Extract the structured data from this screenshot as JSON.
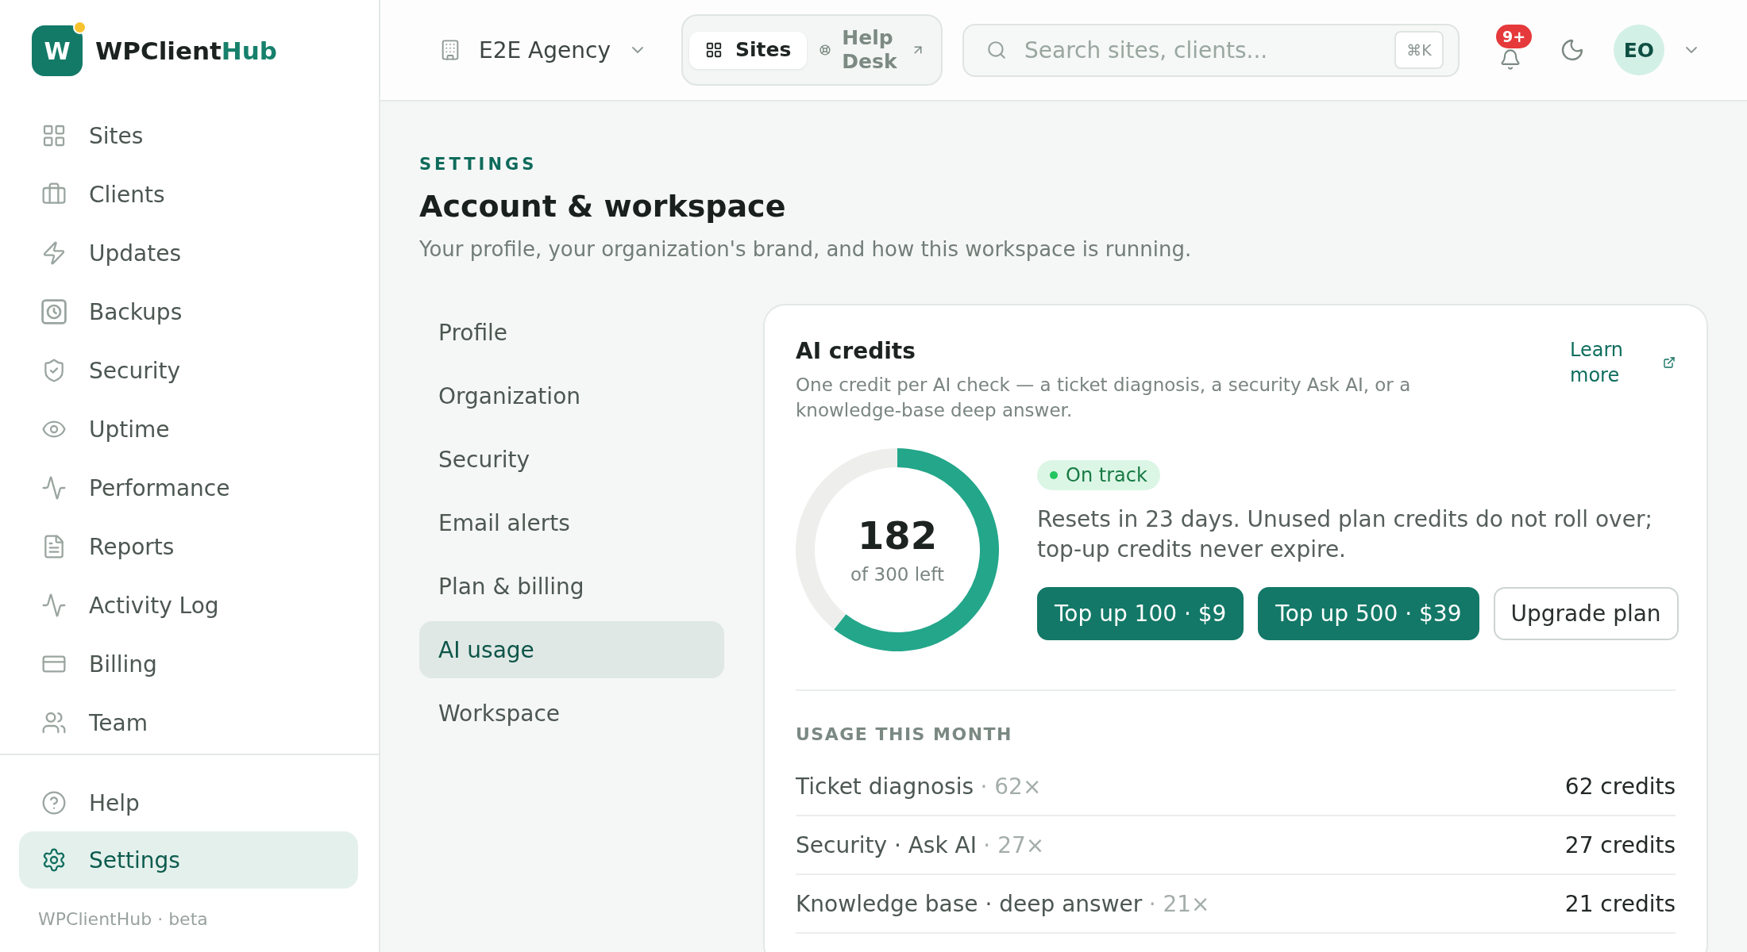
{
  "sidebar": {
    "brand": {
      "mark": "W",
      "name": "WPClient",
      "accent": "Hub"
    },
    "items": [
      {
        "label": "Sites",
        "selected": false
      },
      {
        "label": "Clients",
        "selected": false
      },
      {
        "label": "Updates",
        "selected": false
      },
      {
        "label": "Backups",
        "selected": false
      },
      {
        "label": "Security",
        "selected": false
      },
      {
        "label": "Uptime",
        "selected": false
      },
      {
        "label": "Performance",
        "selected": false
      },
      {
        "label": "Reports",
        "selected": false
      },
      {
        "label": "Activity Log",
        "selected": false
      },
      {
        "label": "Billing",
        "selected": false
      },
      {
        "label": "Team",
        "selected": false
      }
    ],
    "footer_items": [
      {
        "label": "Help",
        "selected": false
      },
      {
        "label": "Settings",
        "selected": true
      }
    ],
    "version": "WPClientHub · beta"
  },
  "topbar": {
    "workspace": "E2E Agency",
    "tabs": [
      {
        "label": "Sites",
        "selected": true
      },
      {
        "label": "Help Desk",
        "selected": false
      }
    ],
    "search": {
      "placeholder": "Search sites, clients...",
      "shortcut": "⌘K"
    },
    "notification_count": "9+",
    "avatar": "EO"
  },
  "page": {
    "eyebrow": "SETTINGS",
    "title": "Account & workspace",
    "subtitle": "Your profile, your organization's brand, and how this workspace is running."
  },
  "settings_nav": [
    {
      "label": "Profile",
      "selected": false
    },
    {
      "label": "Organization",
      "selected": false
    },
    {
      "label": "Security",
      "selected": false
    },
    {
      "label": "Email alerts",
      "selected": false
    },
    {
      "label": "Plan & billing",
      "selected": false
    },
    {
      "label": "AI usage",
      "selected": true
    },
    {
      "label": "Workspace",
      "selected": false
    }
  ],
  "ai_credits": {
    "title": "AI credits",
    "description": "One credit per AI check — a ticket diagnosis, a security Ask AI, or a knowledge-base deep answer.",
    "link": "Learn more",
    "remaining": "182",
    "remaining_caption": "of 300 left",
    "chart_data": {
      "type": "donut",
      "values": [
        60.7,
        39.3
      ]
    },
    "status": "On track",
    "note": "Resets in 23 days. Unused plan credits do not roll over; top-up credits never expire.",
    "buttons": [
      {
        "label": "Top up 100 · $9",
        "kind": "primary"
      },
      {
        "label": "Top up 500 · $39",
        "kind": "primary"
      },
      {
        "label": "Upgrade plan",
        "kind": "secondary"
      }
    ],
    "usage_title": "USAGE THIS MONTH",
    "usage": [
      {
        "label": "Ticket diagnosis",
        "count": "· 62×",
        "credits": "62 credits"
      },
      {
        "label": "Security · Ask AI",
        "count": "· 27×",
        "credits": "27 credits"
      },
      {
        "label": "Knowledge base · deep answer",
        "count": "· 21×",
        "credits": "21 credits"
      }
    ]
  }
}
